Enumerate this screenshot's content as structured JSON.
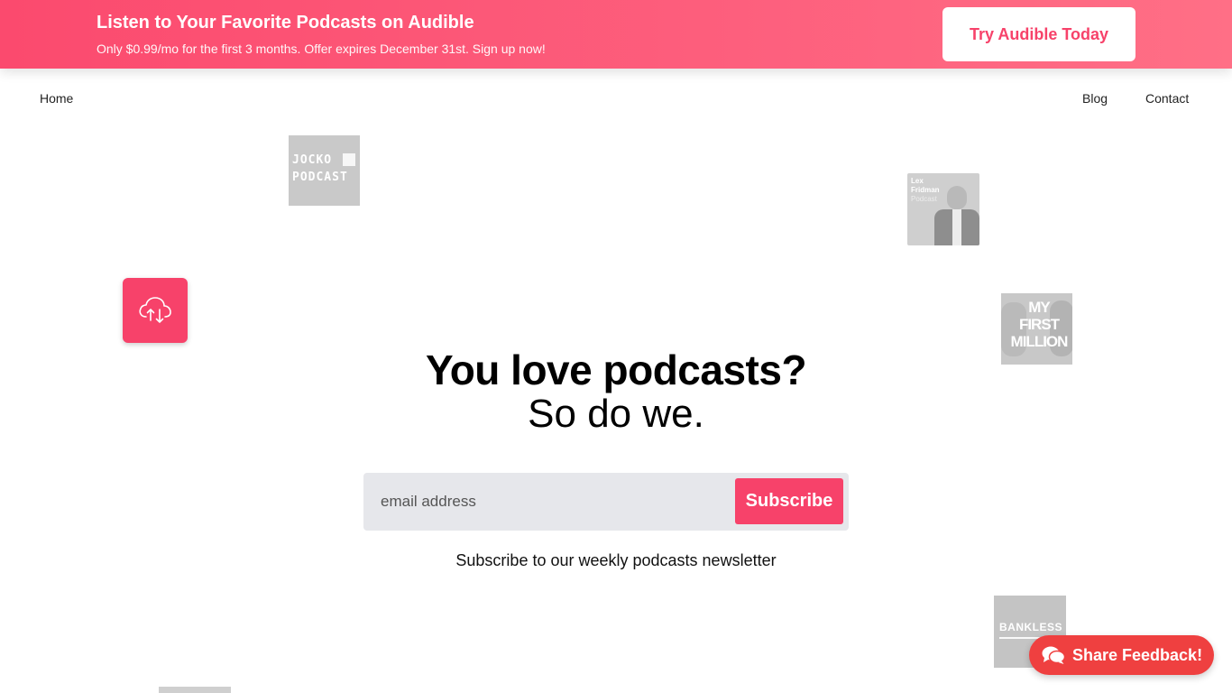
{
  "promo": {
    "title": "Listen to Your Favorite Podcasts on Audible",
    "subtitle": "Only $0.99/mo for the first 3 months. Offer expires December 31st. Sign up now!",
    "cta_label": "Try Audible Today"
  },
  "nav": {
    "home": "Home",
    "blog": "Blog",
    "contact": "Contact"
  },
  "podcast_tiles": {
    "jocko": {
      "line1": "JOCKO",
      "line2": "PODCAST"
    },
    "lex": {
      "line1": "Lex",
      "line2": "Fridman",
      "line3": "Podcast"
    },
    "mfm": {
      "line1": "MY",
      "line2": "FIRST",
      "line3": "MILLION"
    },
    "bankless": {
      "label": "BANKLESS"
    }
  },
  "hero": {
    "title": "You love podcasts?",
    "subtitle": "So do we."
  },
  "signup": {
    "email_placeholder": "email address",
    "email_value": "",
    "subscribe_label": "Subscribe",
    "caption": "Subscribe to our weekly podcasts newsletter"
  },
  "feedback": {
    "label": "Share Feedback!"
  },
  "colors": {
    "brand": "#f7426a",
    "feedback": "#ef4040",
    "input_bg": "#e6e7eb"
  },
  "icons": {
    "app_icon": "cloud-sync-icon",
    "feedback_icon": "chat-bubbles-icon"
  }
}
